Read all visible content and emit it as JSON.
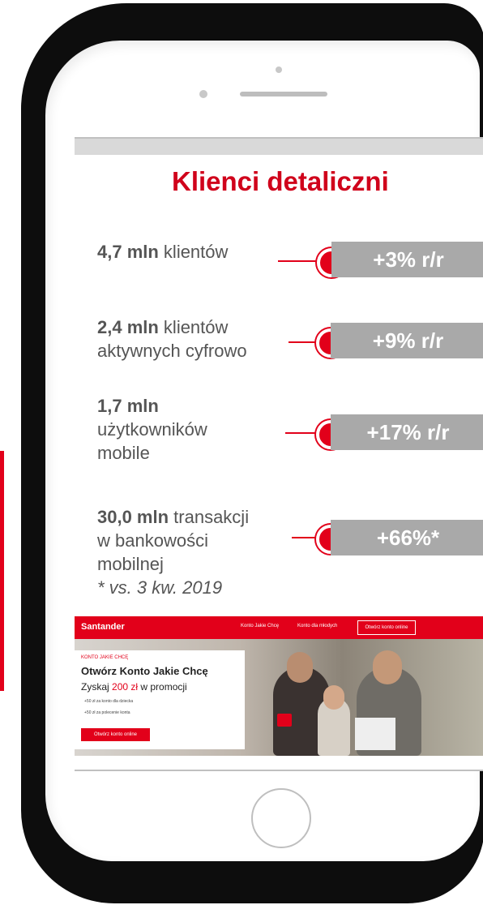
{
  "slide": {
    "title": "Klienci detaliczni",
    "stats": [
      {
        "bold": "4,7 mln",
        "lines": [
          " klientów"
        ],
        "badge": "+3% r/r"
      },
      {
        "bold": "2,4 mln",
        "lines": [
          " klientów",
          "aktywnych cyfrowo"
        ],
        "badge": "+9% r/r"
      },
      {
        "bold": "1,7 mln",
        "lines": [
          "użytkowników",
          "mobile"
        ],
        "badge": "+17% r/r"
      },
      {
        "bold": "30,0 mln",
        "lines": [
          " transakcji",
          "w bankowości",
          "mobilnej"
        ],
        "note": "* vs. 3 kw. 2019",
        "badge": "+66%*"
      }
    ]
  },
  "banner": {
    "logo": "Santander",
    "nav_items": [
      "Konto Jakie Chcę",
      "Konto dla młodych"
    ],
    "nav_button": "Otwórz konto online",
    "small_label": "KONTO JAKIE CHCĘ",
    "headline": "Otwórz Konto Jakie Chcę",
    "sub_prefix": "Zyskaj ",
    "sub_amount": "200 zł",
    "sub_suffix": " w promocji",
    "list": [
      "+50 zł za konto dla dziecka",
      "+50 zł za polecenie konta"
    ],
    "cta": "Otwórz konto online"
  },
  "colors": {
    "accent": "#e2001a",
    "badge": "#a9a9a9",
    "text": "#555555"
  }
}
